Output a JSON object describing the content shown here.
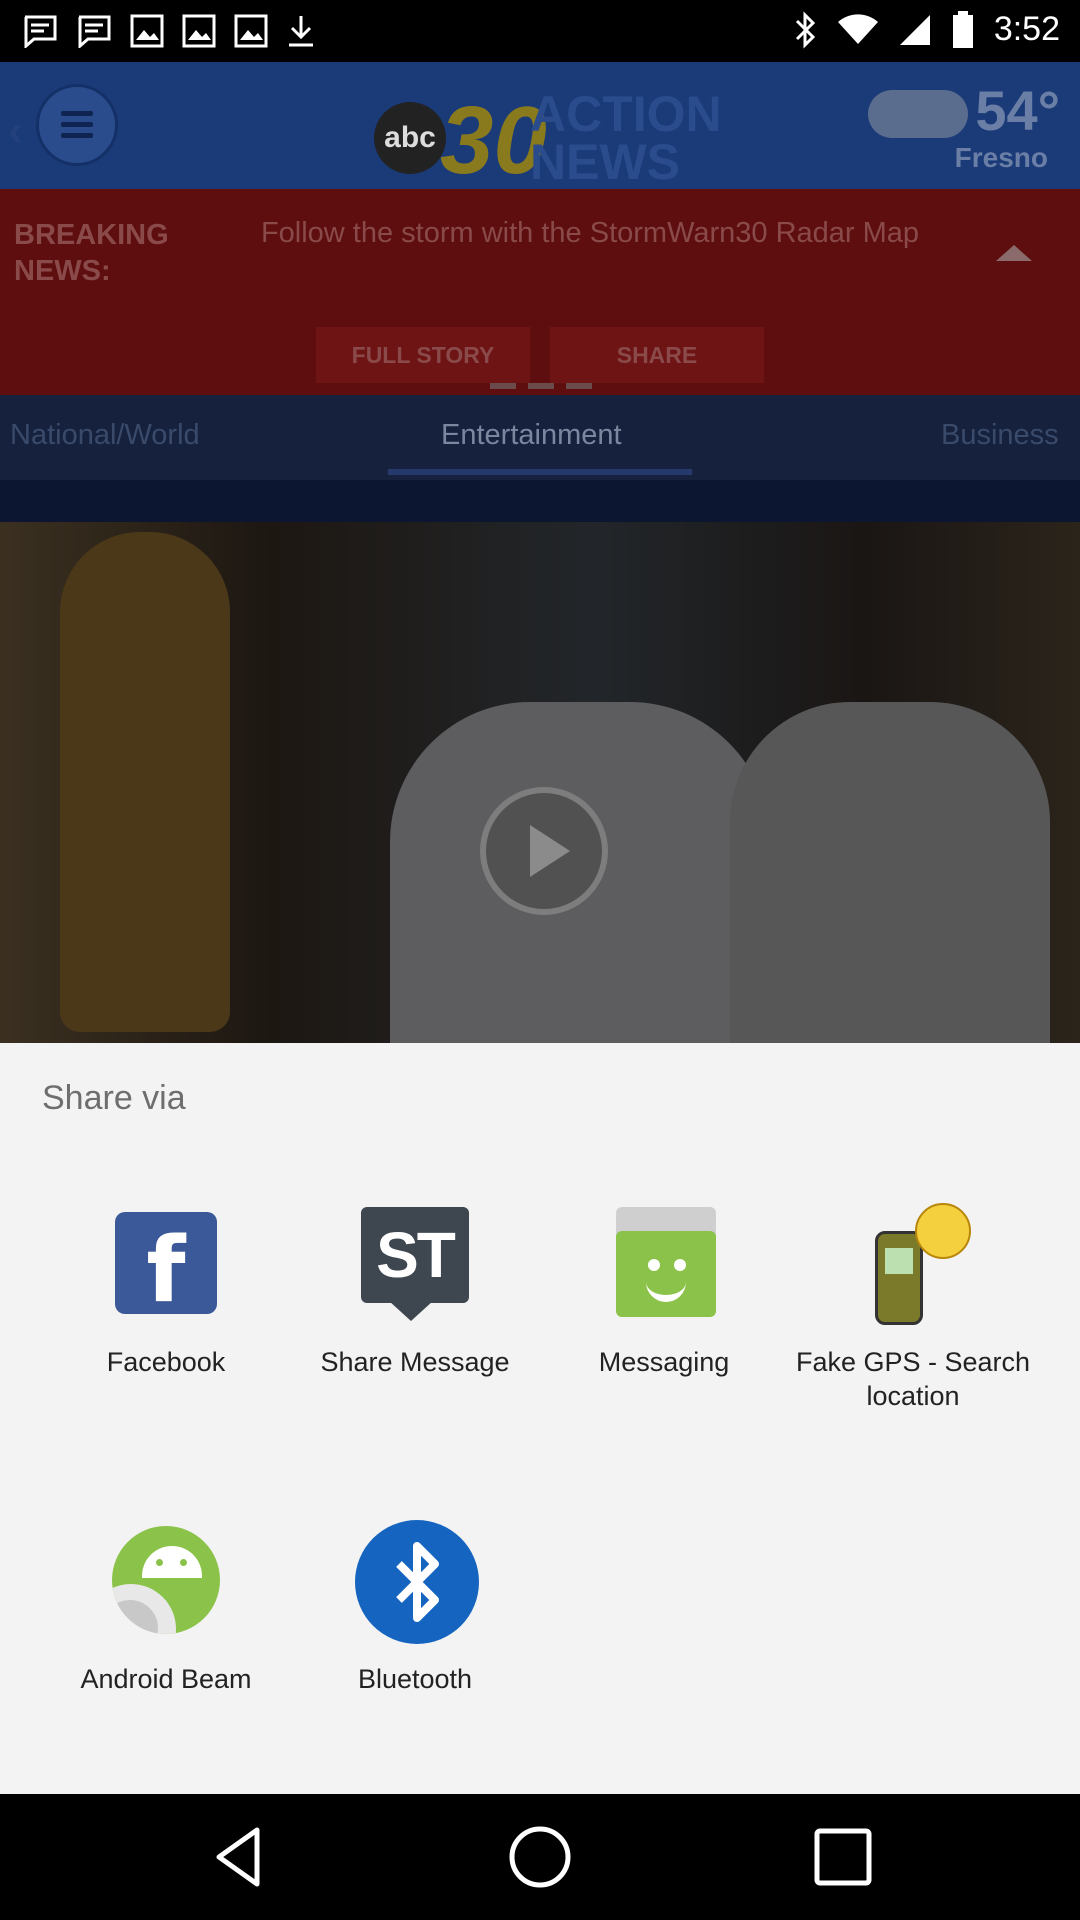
{
  "status_bar": {
    "time": "3:52",
    "left_icons": [
      "message-icon",
      "message-icon",
      "image-icon",
      "image-icon",
      "image-icon",
      "download-icon"
    ],
    "right_icons": [
      "bluetooth-icon",
      "wifi-icon",
      "signal-icon",
      "battery-icon"
    ]
  },
  "app": {
    "logo_abc": "abc",
    "logo_number": "30",
    "logo_line1": "ACTION",
    "logo_line2": "NEWS",
    "weather_temp": "54°",
    "weather_city": "Fresno",
    "breaking_label_line1": "BREAKING",
    "breaking_label_line2": "NEWS:",
    "breaking_text": "Follow the storm with the StormWarn30 Radar Map",
    "full_story_label": "FULL STORY",
    "share_label": "SHARE",
    "tabs": [
      {
        "label": "National/World"
      },
      {
        "label": "Entertainment"
      },
      {
        "label": "Business"
      }
    ]
  },
  "share_sheet": {
    "title": "Share via",
    "apps": [
      {
        "label": "Facebook",
        "icon": "facebook-icon"
      },
      {
        "label": "Share Message",
        "icon": "share-message-icon"
      },
      {
        "label": "Messaging",
        "icon": "messaging-icon"
      },
      {
        "label": "Fake GPS - Search location",
        "icon": "fake-gps-icon"
      },
      {
        "label": "Android Beam",
        "icon": "android-beam-icon"
      },
      {
        "label": "Bluetooth",
        "icon": "bluetooth-icon"
      }
    ]
  },
  "navbar": {
    "icons": [
      "back-icon",
      "home-icon",
      "recents-icon"
    ]
  },
  "colors": {
    "facebook": "#3b5998",
    "share_message": "#3e4750",
    "messaging": "#8bc34a",
    "bluetooth": "#1565c0",
    "sheet_bg": "#f3f3f3"
  }
}
